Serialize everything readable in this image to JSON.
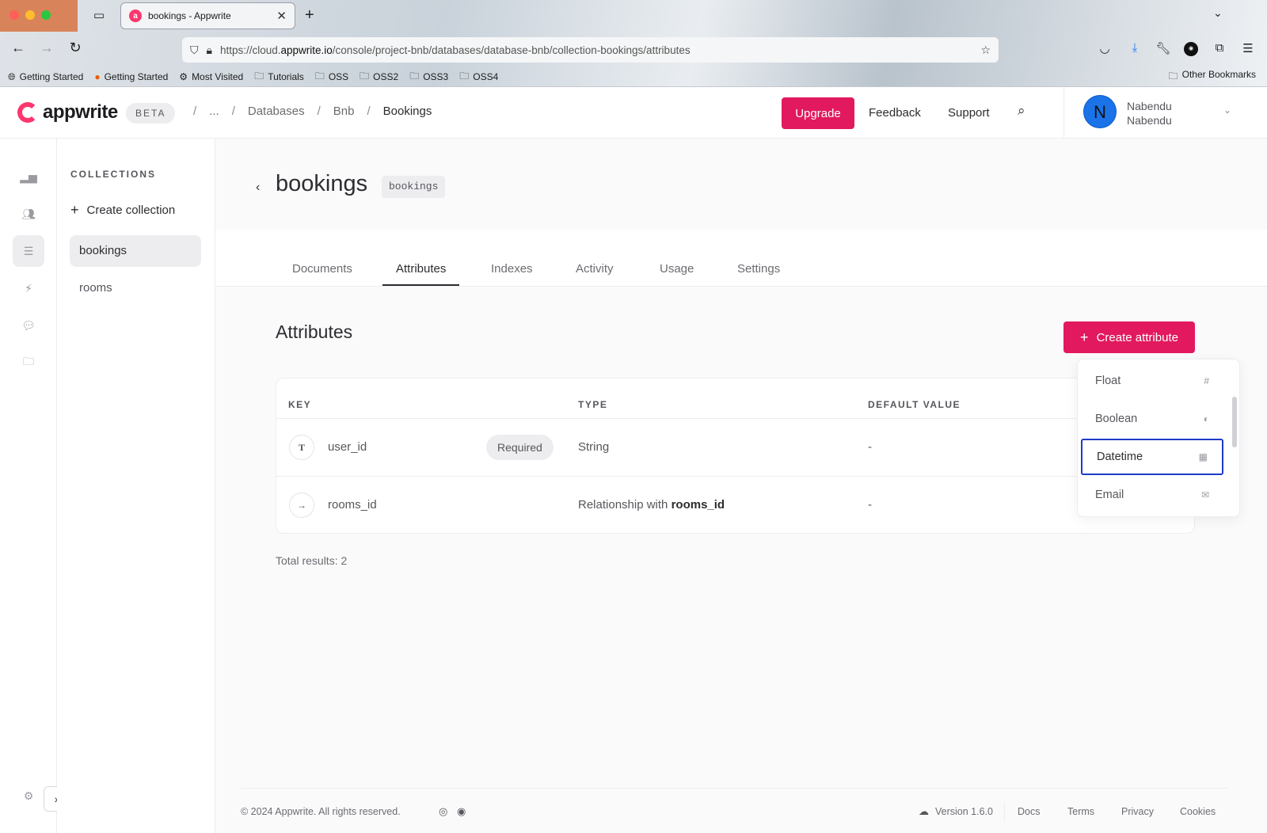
{
  "browser": {
    "tab_title": "bookings - Appwrite",
    "url_prefix": "https://cloud.",
    "url_domain": "appwrite.io",
    "url_path": "/console/project-bnb/databases/database-bnb/collection-bookings/attributes",
    "bookmarks": [
      "Getting Started",
      "Getting Started",
      "Most Visited",
      "Tutorials",
      "OSS",
      "OSS2",
      "OSS3",
      "OSS4"
    ],
    "other_bookmarks": "Other Bookmarks"
  },
  "header": {
    "logo_text": "appwrite",
    "beta": "BETA",
    "breadcrumb": {
      "ellipsis": "...",
      "databases": "Databases",
      "database": "Bnb",
      "collection": "Bookings"
    },
    "upgrade": "Upgrade",
    "feedback": "Feedback",
    "support": "Support",
    "user_initial": "N",
    "user_first": "Nabendu",
    "user_last": "Nabendu"
  },
  "sidebar": {
    "heading": "COLLECTIONS",
    "create": "Create collection",
    "items": [
      {
        "label": "bookings",
        "active": true
      },
      {
        "label": "rooms",
        "active": false
      }
    ]
  },
  "page": {
    "title": "bookings",
    "id": "bookings",
    "tabs": [
      "Documents",
      "Attributes",
      "Indexes",
      "Activity",
      "Usage",
      "Settings"
    ],
    "active_tab": "Attributes"
  },
  "attributes": {
    "title": "Attributes",
    "create_button": "Create attribute",
    "columns": {
      "key": "KEY",
      "type": "TYPE",
      "default": "DEFAULT VALUE"
    },
    "rows": [
      {
        "icon": "T",
        "key": "user_id",
        "badge": "Required",
        "type": "String",
        "type_bold": "",
        "default": "-"
      },
      {
        "icon": "→",
        "key": "rooms_id",
        "badge": "",
        "type": "Relationship with ",
        "type_bold": "rooms_id",
        "default": "-"
      }
    ],
    "total": "Total results: 2"
  },
  "dropdown": {
    "items": [
      {
        "label": "Float",
        "icon": "hash-icon",
        "focused": false
      },
      {
        "label": "Boolean",
        "icon": "toggle-icon",
        "focused": false
      },
      {
        "label": "Datetime",
        "icon": "calendar-icon",
        "focused": true
      },
      {
        "label": "Email",
        "icon": "mail-icon",
        "focused": false
      }
    ]
  },
  "footer": {
    "copyright": "© 2024 Appwrite. All rights reserved.",
    "version": "Version 1.6.0",
    "links": [
      "Docs",
      "Terms",
      "Privacy",
      "Cookies"
    ]
  },
  "colors": {
    "accent": "#e2195e",
    "focus_ring": "#1e3bc8",
    "avatar": "#1a73e8"
  }
}
